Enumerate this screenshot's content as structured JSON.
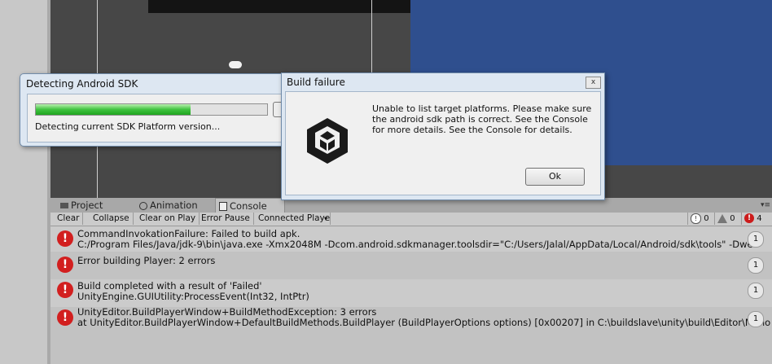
{
  "tabs": {
    "project": "Project",
    "animation": "Animation",
    "console": "Console"
  },
  "toolbar": {
    "clear": "Clear",
    "collapse": "Collapse",
    "clear_on_play": "Clear on Play",
    "error_pause": "Error Pause",
    "connected_player": "Connected Playe",
    "info_count": "0",
    "warning_count": "0",
    "error_count": "4"
  },
  "console": {
    "rows": [
      {
        "line1": "CommandInvokationFailure: Failed to build apk.",
        "line2": "C:/Program Files/Java/jdk-9\\bin\\java.exe -Xmx2048M -Dcom.android.sdkmanager.toolsdir=\"C:/Users/Jalal/AppData/Local/Android/sdk\\tools\" -Dwe",
        "count": "1"
      },
      {
        "line1": "Error building Player: 2 errors",
        "line2": "",
        "count": "1"
      },
      {
        "line1": "Build completed with a result of 'Failed'",
        "line2": "UnityEngine.GUIUtility:ProcessEvent(Int32, IntPtr)",
        "count": "1"
      },
      {
        "line1": "UnityEditor.BuildPlayerWindow+BuildMethodException: 3 errors",
        "line2": "  at UnityEditor.BuildPlayerWindow+DefaultBuildMethods.BuildPlayer (BuildPlayerOptions options) [0x00207] in C:\\buildslave\\unity\\build\\Editor\\Mono",
        "count": "1"
      }
    ]
  },
  "sdk_dialog": {
    "title": "Detecting Android SDK",
    "status": "Detecting current SDK Platform version...",
    "progress": 0.67
  },
  "failure_dialog": {
    "title": "Build failure",
    "close": "x",
    "message": "Unable to list target platforms. Please make sure the android sdk path is correct. See the Console for more details.  See the Console for details.",
    "ok": "Ok"
  },
  "colors": {
    "game_view": "#2f4f8e",
    "error_red": "#d21f1f",
    "progress_green": "#3fc33f"
  }
}
